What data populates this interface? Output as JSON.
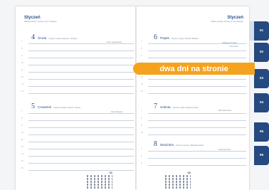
{
  "left_page": {
    "month": "Styczeń",
    "subhead": "Ważne tematy i terminy w tym miesiącu",
    "day1": {
      "num": "4",
      "name": "Środa",
      "names": "Imieniny: Aniela, Eugeniusz, Grzegorz",
      "note": "Dzień sygnatariuszy"
    },
    "day2": {
      "num": "5",
      "name": "Czwartek",
      "names": "Imieniny: Edward, Szymon, Telesfor",
      "note": "Dzień Świętych"
    }
  },
  "right_page": {
    "month": "Styczeń",
    "subhead": "Ważne tematy i terminy w tym miesiącu",
    "day1": {
      "num": "6",
      "name": "Piątek",
      "names": "Imieniny: Kacper, Melchior, Baltazar",
      "note": "Objawienie Pańskie",
      "note2": "Trzech Króli"
    },
    "day2": {
      "num": "7",
      "name": "Sobota",
      "names": "Imieniny: Lucjan, Rajmund, Julian",
      "note": "Boże Narodzenie"
    },
    "day3": {
      "num": "8",
      "name": "Niedziela",
      "names": "Imieniny: Seweryn, Mścisław, Erhard",
      "note": "Niedziela Chrztu"
    }
  },
  "hours": [
    "7",
    "8",
    "9",
    "10",
    "11",
    "12",
    "13",
    "14",
    "15",
    "16",
    "17",
    "18",
    "19",
    "20"
  ],
  "mini_cal_left": {
    "label": "01"
  },
  "mini_cal_right": {
    "label": "02"
  },
  "tabs": [
    "01",
    "02",
    "03",
    "04",
    "05",
    "06"
  ],
  "banner": "dwa dni na stronie",
  "colors": {
    "accent": "#244a80",
    "banner": "#f5a21e",
    "rule": "#c9d2de"
  }
}
